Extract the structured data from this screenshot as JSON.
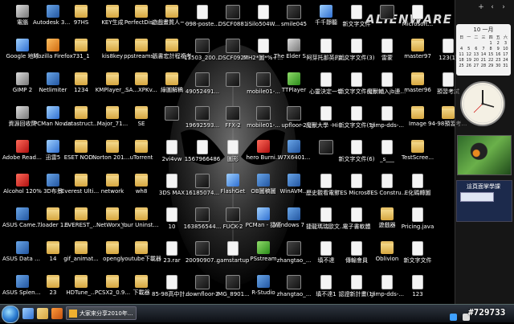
{
  "brand_text": "ALIENWARE",
  "desktop_icons": [
    {
      "label": "電腦",
      "col": 0,
      "row": 0,
      "kind": "gray"
    },
    {
      "label": "Google 地球",
      "col": 0,
      "row": 1,
      "kind": "blue"
    },
    {
      "label": "GIMP 2",
      "col": 0,
      "row": 2,
      "kind": "gray"
    },
    {
      "label": "資源回收筒",
      "col": 0,
      "row": 3,
      "kind": "gray"
    },
    {
      "label": "Adobe Reader 9",
      "col": 0,
      "row": 4,
      "kind": "red"
    },
    {
      "label": "Alcohol 120%",
      "col": 0,
      "row": 5,
      "kind": "red"
    },
    {
      "label": "ASUS Camera Sc...",
      "col": 0,
      "row": 6,
      "kind": "app"
    },
    {
      "label": "ASUS Data Security ...",
      "col": 0,
      "row": 7,
      "kind": "app"
    },
    {
      "label": "ASUS Splendid ...",
      "col": 0,
      "row": 8,
      "kind": "app"
    },
    {
      "label": "Autodesk 3ds Max ...",
      "col": 1,
      "row": 0,
      "kind": "app"
    },
    {
      "label": "Mozilla Firefox",
      "col": 1,
      "row": 1,
      "kind": "orange"
    },
    {
      "label": "Netlimiter",
      "col": 1,
      "row": 2,
      "kind": "app"
    },
    {
      "label": "PCMan Novus",
      "col": 1,
      "row": 3,
      "kind": "blue"
    },
    {
      "label": "迅雷5",
      "col": 1,
      "row": 4,
      "kind": "blue"
    },
    {
      "label": "3D布景",
      "col": 1,
      "row": 5,
      "kind": "app"
    },
    {
      "label": "7loader 1.5",
      "col": 1,
      "row": 6,
      "kind": "folder"
    },
    {
      "label": "14",
      "col": 1,
      "row": 7,
      "kind": "folder"
    },
    {
      "label": "23",
      "col": 1,
      "row": 8,
      "kind": "folder"
    },
    {
      "label": "97HS",
      "col": 2,
      "row": 0,
      "kind": "folder"
    },
    {
      "label": "731_1",
      "col": 2,
      "row": 1,
      "kind": "folder"
    },
    {
      "label": "1234",
      "col": 2,
      "row": 2,
      "kind": "folder"
    },
    {
      "label": "datastruct...",
      "col": 2,
      "row": 3,
      "kind": "folder"
    },
    {
      "label": "ESET NOD...",
      "col": 2,
      "row": 4,
      "kind": "folder"
    },
    {
      "label": "Everest Ultimate E...",
      "col": 2,
      "row": 5,
      "kind": "folder"
    },
    {
      "label": "EVEREST_...",
      "col": 2,
      "row": 6,
      "kind": "folder"
    },
    {
      "label": "gif_animat...",
      "col": 2,
      "row": 7,
      "kind": "folder"
    },
    {
      "label": "HDTune_...",
      "col": 2,
      "row": 8,
      "kind": "folder"
    },
    {
      "label": "KEY生成",
      "col": 3,
      "row": 0,
      "kind": "folder"
    },
    {
      "label": "kis8key",
      "col": 3,
      "row": 1,
      "kind": "folder"
    },
    {
      "label": "KMPlayer_...",
      "col": 3,
      "row": 2,
      "kind": "folder"
    },
    {
      "label": "Major_71...",
      "col": 3,
      "row": 3,
      "kind": "folder"
    },
    {
      "label": "Norton 2010 [Tri...",
      "col": 3,
      "row": 4,
      "kind": "folder"
    },
    {
      "label": "network",
      "col": 3,
      "row": 5,
      "kind": "folder"
    },
    {
      "label": "NetWorx_...",
      "col": 3,
      "row": 6,
      "kind": "folder"
    },
    {
      "label": "opengl",
      "col": 3,
      "row": 7,
      "kind": "folder"
    },
    {
      "label": "PCSX2_0.9...",
      "col": 3,
      "row": 8,
      "kind": "folder"
    },
    {
      "label": "PerfectDis...",
      "col": 4,
      "row": 0,
      "kind": "folder"
    },
    {
      "label": "ppstreams...",
      "col": 4,
      "row": 1,
      "kind": "folder"
    },
    {
      "label": "SA...XPKv...",
      "col": 4,
      "row": 2,
      "kind": "folder"
    },
    {
      "label": "SE",
      "col": 4,
      "row": 3,
      "kind": "folder"
    },
    {
      "label": "uTorrent",
      "col": 4,
      "row": 4,
      "kind": "folder"
    },
    {
      "label": "wh8",
      "col": 4,
      "row": 5,
      "kind": "folder"
    },
    {
      "label": "Your Uninstalle...",
      "col": 4,
      "row": 6,
      "kind": "folder"
    },
    {
      "label": "youtube下載器",
      "col": 4,
      "row": 7,
      "kind": "folder"
    },
    {
      "label": "下載器",
      "col": 4,
      "row": 8,
      "kind": "folder"
    },
    {
      "label": "遊戲畫質人~的文~Simple...",
      "col": 5,
      "row": 0,
      "kind": "folder"
    },
    {
      "label": "張書宏計程複考",
      "col": 5,
      "row": 1,
      "kind": "folder"
    },
    {
      "label": "綠圖解稿",
      "col": 5,
      "row": 2,
      "kind": "folder"
    },
    {
      "label": "",
      "col": 5,
      "row": 3,
      "kind": "none"
    },
    {
      "label": "2vi4vw",
      "col": 5,
      "row": 4,
      "kind": "file"
    },
    {
      "label": "3DS MAX",
      "col": 5,
      "row": 5,
      "kind": "file"
    },
    {
      "label": "10",
      "col": 5,
      "row": 6,
      "kind": "file"
    },
    {
      "label": "23.rar",
      "col": 5,
      "row": 7,
      "kind": "file"
    },
    {
      "label": "85-98高中計大學_國民...",
      "col": 5,
      "row": 8,
      "kind": "file"
    },
    {
      "label": "098-poste...",
      "col": 6,
      "row": 0,
      "kind": "file"
    },
    {
      "label": "13503_200...",
      "col": 6,
      "row": 1,
      "kind": "media"
    },
    {
      "label": "49052491...",
      "col": 6,
      "row": 2,
      "kind": "media"
    },
    {
      "label": "19692593...",
      "col": 6,
      "row": 3,
      "kind": "media"
    },
    {
      "label": "1567966486",
      "col": 6,
      "row": 4,
      "kind": "file"
    },
    {
      "label": "16185074...",
      "col": 6,
      "row": 5,
      "kind": "media"
    },
    {
      "label": "163856544...",
      "col": 6,
      "row": 6,
      "kind": "media"
    },
    {
      "label": "20090907...",
      "col": 6,
      "row": 7,
      "kind": "media"
    },
    {
      "label": "downfloor-2",
      "col": 6,
      "row": 8,
      "kind": "media"
    },
    {
      "label": "DSCF0881",
      "col": 7,
      "row": 0,
      "kind": "media"
    },
    {
      "label": "DSCF0922",
      "col": 7,
      "row": 1,
      "kind": "media"
    },
    {
      "label": "",
      "col": 7,
      "row": 2,
      "kind": "none"
    },
    {
      "label": "FFX-2",
      "col": 7,
      "row": 3,
      "kind": "media"
    },
    {
      "label": "圖形",
      "col": 7,
      "row": 4,
      "kind": "file"
    },
    {
      "label": "FlashGet",
      "col": 7,
      "row": 5,
      "kind": "blue"
    },
    {
      "label": "FUCK-2",
      "col": 7,
      "row": 6,
      "kind": "media"
    },
    {
      "label": "gamstartup",
      "col": 7,
      "row": 7,
      "kind": "file"
    },
    {
      "label": "IMG_8901...",
      "col": 7,
      "row": 8,
      "kind": "media"
    },
    {
      "label": "iSilo504W...",
      "col": 8,
      "row": 0,
      "kind": "file"
    },
    {
      "label": "MH2*圖*%+online©",
      "col": 8,
      "row": 1,
      "kind": "file"
    },
    {
      "label": "mobile01-...",
      "col": 8,
      "row": 2,
      "kind": "media"
    },
    {
      "label": "mobile01-...",
      "col": 8,
      "row": 3,
      "kind": "media"
    },
    {
      "label": "hero Burni...",
      "col": 8,
      "row": 4,
      "kind": "red"
    },
    {
      "label": "OB圖稿圖",
      "col": 8,
      "row": 5,
      "kind": "app"
    },
    {
      "label": "PCMan - 捷徑",
      "col": 8,
      "row": 6,
      "kind": "blue"
    },
    {
      "label": "PSstream",
      "col": 8,
      "row": 7,
      "kind": "green"
    },
    {
      "label": "R-Studio",
      "col": 8,
      "row": 8,
      "kind": "app"
    },
    {
      "label": "smile045",
      "col": 9,
      "row": 0,
      "kind": "media"
    },
    {
      "label": "The Elder Scrolls Con...",
      "col": 9,
      "row": 1,
      "kind": "gray"
    },
    {
      "label": "TTPlayer",
      "col": 9,
      "row": 2,
      "kind": "green"
    },
    {
      "label": "upfloor-2",
      "col": 9,
      "row": 3,
      "kind": "media"
    },
    {
      "label": "W7X6401...",
      "col": 9,
      "row": 4,
      "kind": "app"
    },
    {
      "label": "WinAVM...",
      "col": 9,
      "row": 5,
      "kind": "app"
    },
    {
      "label": "Windows 7 共面主題",
      "col": 9,
      "row": 6,
      "kind": "app"
    },
    {
      "label": "zhangtao_...",
      "col": 9,
      "row": 7,
      "kind": "media"
    },
    {
      "label": "zhangtao_...",
      "col": 9,
      "row": 8,
      "kind": "media"
    },
    {
      "label": "千千靜聽",
      "col": 10,
      "row": 0,
      "kind": "blue"
    },
    {
      "label": "阿芽托那英的心",
      "col": 10,
      "row": 1,
      "kind": "file"
    },
    {
      "label": "心靈決定一切",
      "col": 10,
      "row": 2,
      "kind": "file"
    },
    {
      "label": "魔獸大學 -Hi-CMMH",
      "col": 10,
      "row": 3,
      "kind": "file"
    },
    {
      "label": "",
      "col": 10,
      "row": 4,
      "kind": "none"
    },
    {
      "label": "歷史觀看電影的方法",
      "col": 10,
      "row": 5,
      "kind": "file"
    },
    {
      "label": "捷龍瑪瑞歐文教學1.0版",
      "col": 10,
      "row": 6,
      "kind": "file"
    },
    {
      "label": "填不達",
      "col": 10,
      "row": 7,
      "kind": "file"
    },
    {
      "label": "填不達1",
      "col": 10,
      "row": 8,
      "kind": "file"
    },
    {
      "label": "新文字文件",
      "col": 11,
      "row": 0,
      "kind": "file"
    },
    {
      "label": "新文字文件(3)",
      "col": 11,
      "row": 1,
      "kind": "file"
    },
    {
      "label": "新文字文件(4)",
      "col": 11,
      "row": 2,
      "kind": "file"
    },
    {
      "label": "新文字文件(5)",
      "col": 11,
      "row": 3,
      "kind": "file"
    },
    {
      "label": "新文字文件(6)",
      "col": 11,
      "row": 4,
      "kind": "file"
    },
    {
      "label": "TES Microsoft...",
      "col": 11,
      "row": 5,
      "kind": "file"
    },
    {
      "label": "電子書軟體",
      "col": 11,
      "row": 6,
      "kind": "file"
    },
    {
      "label": "傳輸會員",
      "col": 11,
      "row": 7,
      "kind": "file"
    },
    {
      "label": "認證新計畫(1)",
      "col": 11,
      "row": 8,
      "kind": "file"
    },
    {
      "label": "",
      "col": 12,
      "row": 0,
      "kind": "none"
    },
    {
      "label": "雷蒙",
      "col": 12,
      "row": 1,
      "kind": "file"
    },
    {
      "label": "魔獸輔入jb連接檔式",
      "col": 12,
      "row": 2,
      "kind": "file"
    },
    {
      "label": "gimp-dds-...",
      "col": 12,
      "row": 3,
      "kind": "file"
    },
    {
      "label": "_s___",
      "col": 12,
      "row": 4,
      "kind": "file"
    },
    {
      "label": "TES Constructi...",
      "col": 12,
      "row": 5,
      "kind": "file"
    },
    {
      "label": "遊戲器",
      "col": 12,
      "row": 6,
      "kind": "folder"
    },
    {
      "label": "Oblivion",
      "col": 12,
      "row": 7,
      "kind": "folder"
    },
    {
      "label": "gimp-dds-...",
      "col": 12,
      "row": 8,
      "kind": "file"
    },
    {
      "label": "Microsoft...",
      "col": 13,
      "row": 0,
      "kind": "file"
    },
    {
      "label": "master97",
      "col": 13,
      "row": 1,
      "kind": "folder"
    },
    {
      "label": "master96",
      "col": 13,
      "row": 2,
      "kind": "folder"
    },
    {
      "label": "Image",
      "col": 13,
      "row": 3,
      "kind": "folder"
    },
    {
      "label": "TestScree...",
      "col": 13,
      "row": 4,
      "kind": "folder"
    },
    {
      "label": "E化碼轉圖",
      "col": 13,
      "row": 5,
      "kind": "file"
    },
    {
      "label": "Pricing.java",
      "col": 13,
      "row": 6,
      "kind": "file"
    },
    {
      "label": "新文字文件",
      "col": 13,
      "row": 7,
      "kind": "file"
    },
    {
      "label": "123",
      "col": 13,
      "row": 8,
      "kind": "file"
    },
    {
      "label": "123(1)",
      "col": 14,
      "row": 1,
      "kind": "file"
    },
    {
      "label": "預習考試",
      "col": 14,
      "row": 2,
      "kind": "file"
    },
    {
      "label": "94-98預習考古題",
      "col": 14,
      "row": 3,
      "kind": "folder"
    }
  ],
  "sidebar": {
    "controls": [
      "+",
      "‹",
      "›"
    ],
    "calendar": {
      "month_label": "10 一月",
      "weekdays": [
        "日",
        "一",
        "二",
        "三",
        "四",
        "五",
        "六"
      ],
      "days": [
        "",
        "",
        "",
        "",
        "1",
        "2",
        "3",
        "4",
        "5",
        "6",
        "7",
        "8",
        "9",
        "10",
        "11",
        "12",
        "13",
        "14",
        "15",
        "16",
        "17",
        "18",
        "19",
        "20",
        "21",
        "22",
        "23",
        "24",
        "25",
        "26",
        "27",
        "28",
        "29",
        "30",
        "31"
      ]
    },
    "feed_title": "這頁面掌學課"
  },
  "taskbar": {
    "task_item_label": "大家來分享2010年..."
  },
  "watermark": "#729733",
  "colors": {
    "taskbar_top": "#2f3640",
    "start_orb": "#2a7ad0"
  }
}
